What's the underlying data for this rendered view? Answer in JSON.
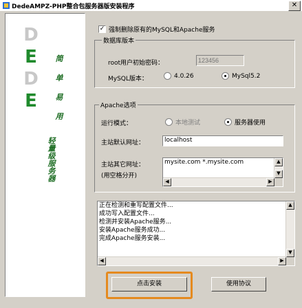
{
  "window": {
    "title": "DedeAMPZ-PHP整合包服务器版安装程序",
    "close_glyph": "✕"
  },
  "branding": {
    "logo_letters": [
      "D",
      "E",
      "D",
      "E"
    ],
    "slogan_col1": [
      "简",
      "单",
      "易",
      "用"
    ],
    "slogan_col2": "轻量级服务器"
  },
  "options": {
    "delete_checkbox_label": "强制删除原有的MySQL和Apache服务",
    "delete_checked": true
  },
  "database": {
    "group_label": "数据库版本",
    "root_password_label": "root用户初始密码：",
    "root_password_placeholder": "123456",
    "mysql_version_label": "MySQL版本：",
    "versions": [
      {
        "label": "4.0.26",
        "selected": false
      },
      {
        "label": "MySql5.2",
        "selected": true
      }
    ]
  },
  "apache": {
    "group_label": "Apache选项",
    "run_mode_label": "运行模式：",
    "modes": [
      {
        "label": "本地测试",
        "selected": false,
        "enabled": false
      },
      {
        "label": "服务器使用",
        "selected": true,
        "enabled": true
      }
    ],
    "default_host_label": "主站默认网址：",
    "default_host_value": "localhost",
    "other_hosts_label": "主站其它网址：",
    "other_hosts_hint": "(用空格分开)",
    "other_hosts_value": "mysite.com *.mysite.com"
  },
  "log": {
    "lines": [
      "正在检测和重写配置文件...",
      "成功写入配置文件...",
      "检测并安装Apache服务...",
      "安装Apache服务成功...",
      "完成Apache服务安装..."
    ]
  },
  "buttons": {
    "install_label": "点击安装",
    "license_label": "使用协议"
  },
  "colors": {
    "accent_highlight": "#e58a1f",
    "logo_green": "#1f8a2c"
  }
}
